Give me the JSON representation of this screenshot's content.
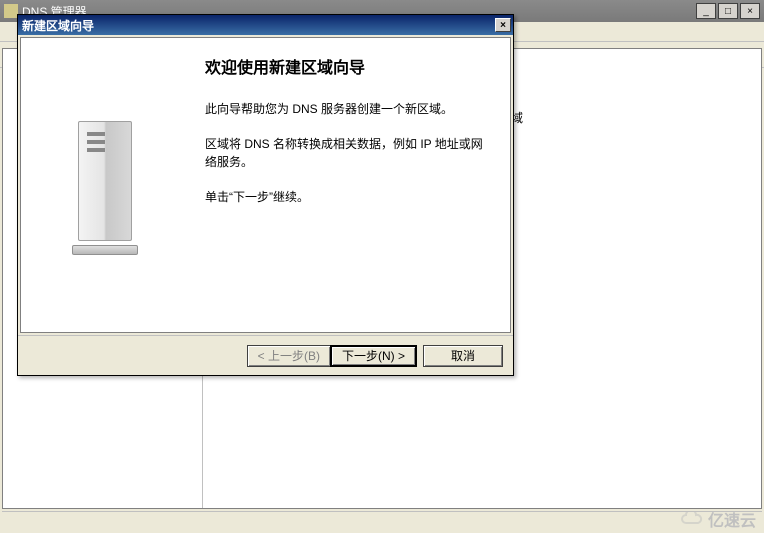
{
  "main_window": {
    "title": "DNS 管理器",
    "sys_min": "_",
    "sys_max": "□",
    "sys_close": "×"
  },
  "content": {
    "bg_line1": "域存储有关一个或多个连续的 DNS 域",
    "bg_line2": "” 。"
  },
  "wizard": {
    "title": "新建区域向导",
    "close": "×",
    "heading": "欢迎使用新建区域向导",
    "p1": "此向导帮助您为 DNS 服务器创建一个新区域。",
    "p2": "区域将 DNS 名称转换成相关数据，例如 IP 地址或网络服务。",
    "p3": "单击“下一步”继续。",
    "btn_back": "< 上一步(B)",
    "btn_next": "下一步(N) >",
    "btn_cancel": "取消"
  },
  "watermark": {
    "text": "亿速云"
  }
}
